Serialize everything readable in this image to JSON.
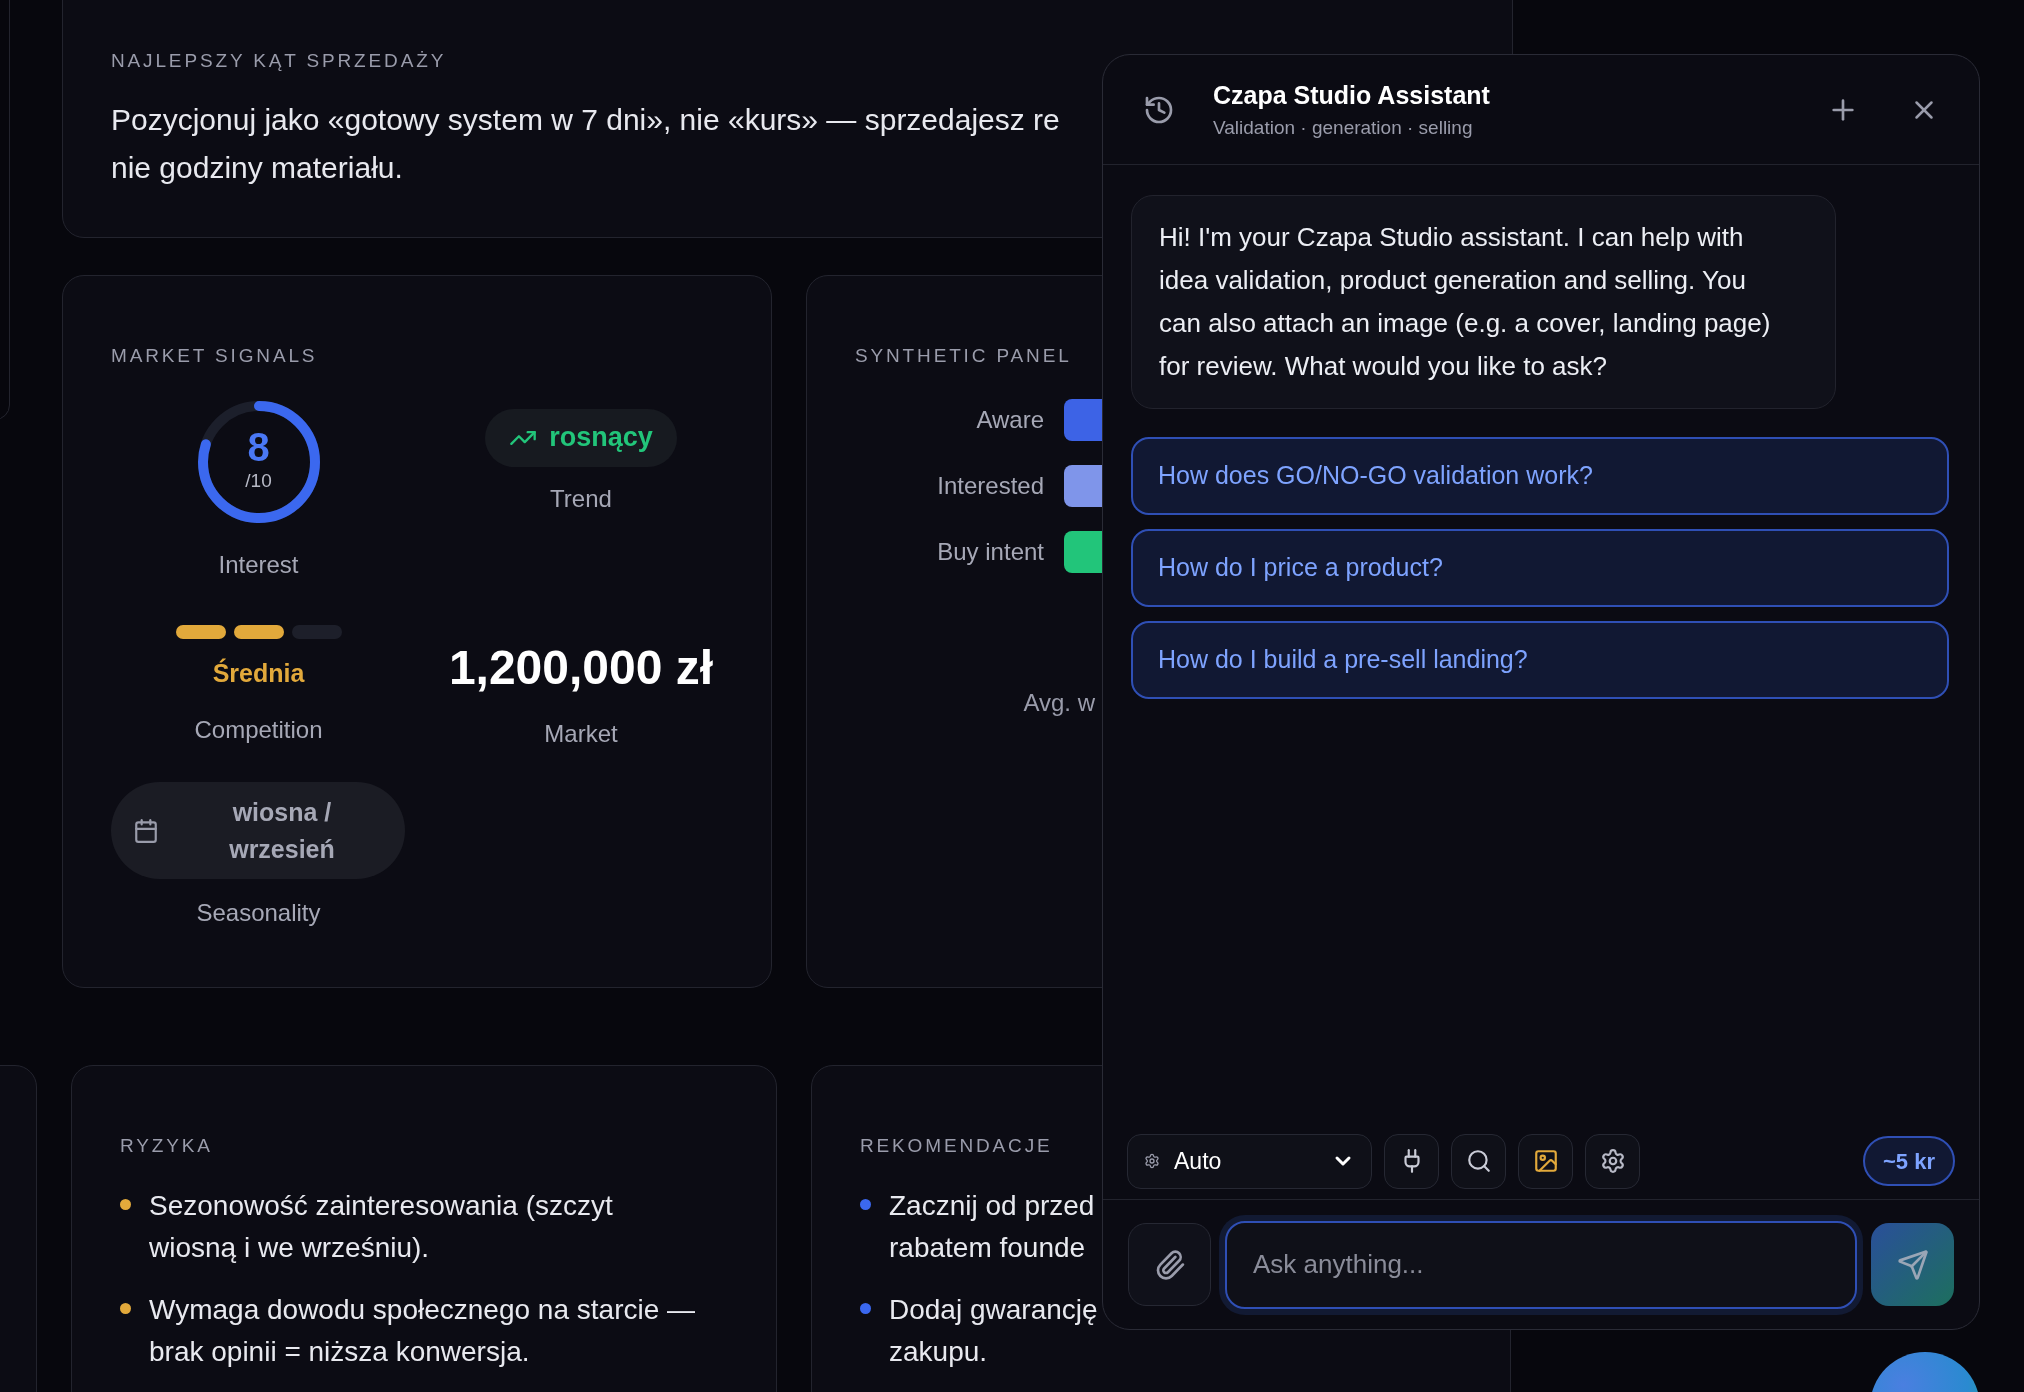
{
  "best_angle": {
    "label": "NAJLEPSZY KĄT SPRZEDAŻY",
    "lines": [
      "Pozycjonuj jako «gotowy system w 7 dni», nie «kurs» — sprzedajesz re",
      "nie godziny materiału."
    ]
  },
  "market_signals": {
    "title": "MARKET SIGNALS",
    "interest": {
      "score": "8",
      "scale": "/10",
      "level": 0.8,
      "label": "Interest"
    },
    "trend": {
      "value": "rosnący",
      "label": "Trend"
    },
    "competition": {
      "value": "Średnia",
      "label": "Competition",
      "segments": [
        {
          "on": true
        },
        {
          "on": true
        },
        {
          "on": false
        }
      ]
    },
    "market": {
      "value": "1,200,000 zł",
      "label": "Market"
    },
    "seasonality": {
      "value": "wiosna / wrzesień",
      "label": "Seasonality"
    }
  },
  "synthetic_panel": {
    "title": "SYNTHETIC PANEL",
    "rows": [
      {
        "label": "Aware",
        "color": "#3d63e6"
      },
      {
        "label": "Interested",
        "color": "#7f95ea"
      },
      {
        "label": "Buy intent",
        "color": "#22c57a"
      }
    ],
    "avg_label": "Avg. w"
  },
  "risks": {
    "title": "RYZYKA",
    "items": [
      "Sezonowość zainteresowania (szczyt wiosną i we wrześniu).",
      "Wymaga dowodu społecznego na starcie — brak opinii = niższa konwersja."
    ]
  },
  "recommendations": {
    "title": "REKOMENDACJE",
    "items": [
      {
        "lines": [
          "Zacznij od przed",
          "rabatem founde"
        ]
      },
      {
        "lines": [
          "Dodaj gwarancję",
          "zakupu."
        ]
      }
    ]
  },
  "chat": {
    "title": "Czapa Studio Assistant",
    "subtitle": "Validation · generation · selling",
    "message": "Hi! I'm your Czapa Studio assistant. I can help with idea validation, product generation and selling. You can also attach an image (e.g. a cover, landing page) for review. What would you like to ask?",
    "suggestions": [
      "How does GO/NO-GO validation work?",
      "How do I price a product?",
      "How do I build a pre-sell landing?"
    ],
    "mode": "Auto",
    "credits": "~5 kr",
    "placeholder": "Ask anything..."
  }
}
